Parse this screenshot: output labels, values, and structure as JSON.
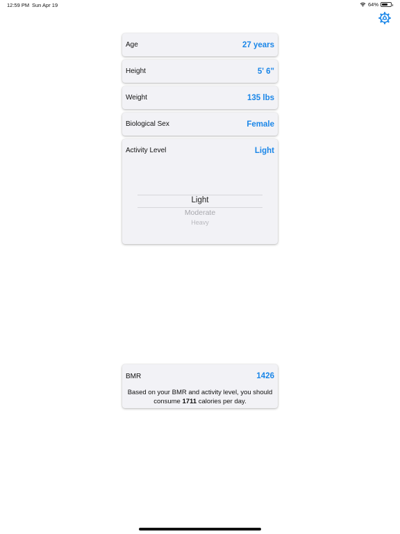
{
  "status_bar": {
    "time": "12:59 PM",
    "date": "Sun Apr 19",
    "battery_text": "64%",
    "battery_level": 0.64
  },
  "settings": {
    "icon": "gear-icon"
  },
  "fields": {
    "age": {
      "label": "Age",
      "value": "27 years"
    },
    "height": {
      "label": "Height",
      "value": "5' 6\""
    },
    "weight": {
      "label": "Weight",
      "value": "135 lbs"
    },
    "sex": {
      "label": "Biological Sex",
      "value": "Female"
    },
    "activity": {
      "label": "Activity Level",
      "value": "Light",
      "options": [
        "Light",
        "Moderate",
        "Heavy"
      ],
      "selected": "Light"
    }
  },
  "bmr": {
    "label": "BMR",
    "value": "1426",
    "text_before": "Based on your BMR and activity level, you should consume ",
    "calories": "1711",
    "text_after": " calories per day."
  },
  "colors": {
    "accent": "#1a86e8",
    "card_bg": "#f2f2f6"
  }
}
